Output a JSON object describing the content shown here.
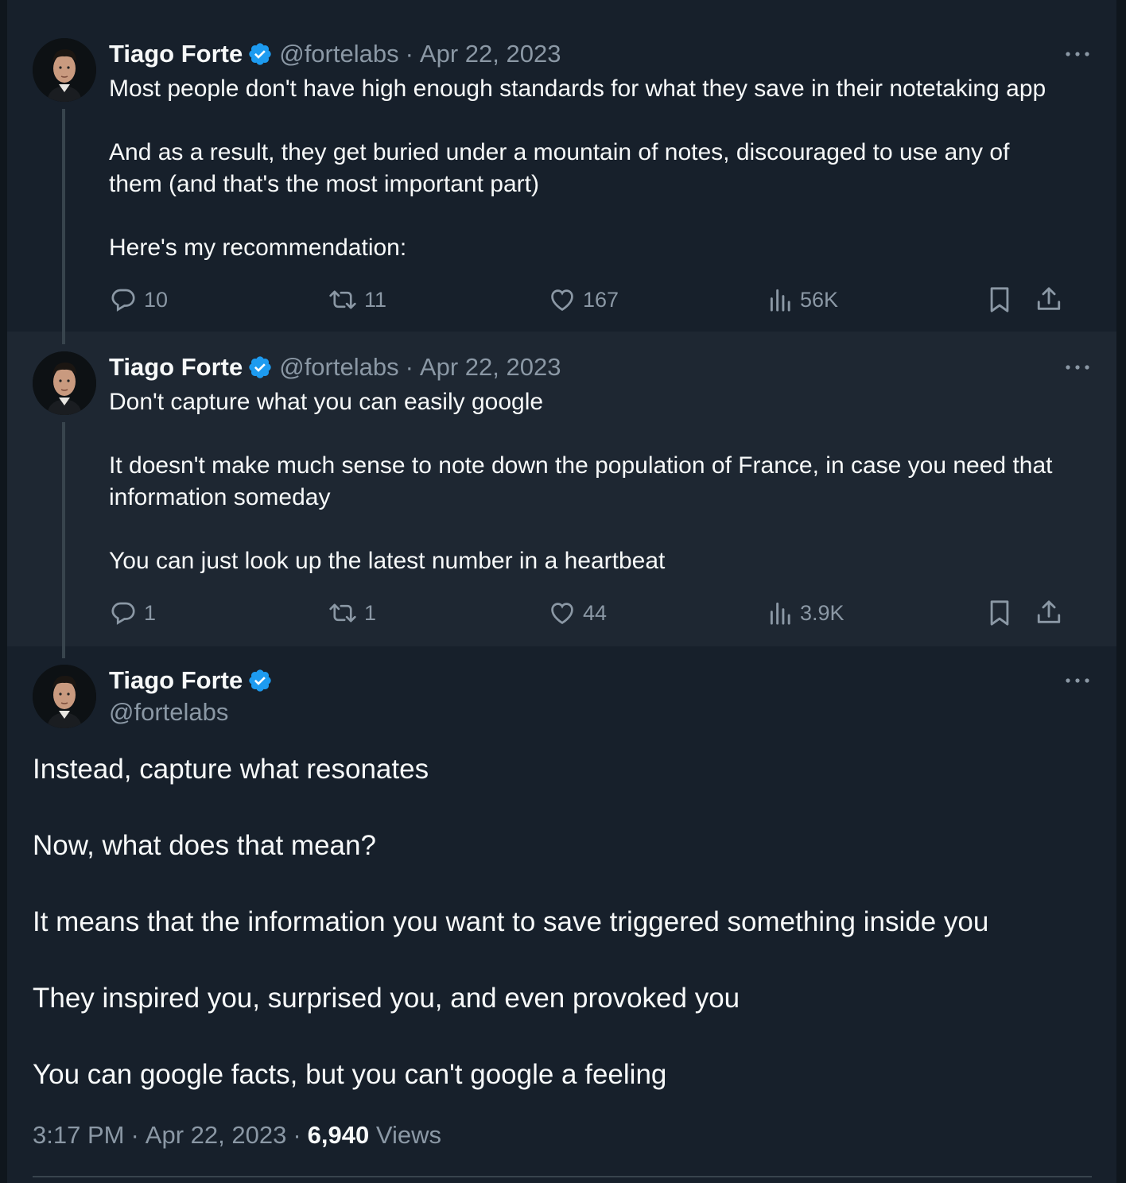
{
  "author": {
    "name": "Tiago Forte",
    "handle": "@fortelabs",
    "verified_color": "#1d9bf0"
  },
  "tweets": [
    {
      "date": "Apr 22, 2023",
      "lines": [
        "Most people don't have high enough standards for what they save in their notetaking app",
        "",
        "And as a result, they get buried under a mountain of notes, discouraged to use any of",
        "them (and that's the most important part)",
        "",
        "Here's my recommendation:"
      ],
      "replies": "10",
      "retweets": "11",
      "likes": "167",
      "views": "56K"
    },
    {
      "date": "Apr 22, 2023",
      "lines": [
        "Don't capture what you can easily google",
        "",
        "It doesn't make much sense to note down the population of France, in case you need that",
        "information someday",
        "",
        "You can just look up the latest number in a heartbeat"
      ],
      "replies": "1",
      "retweets": "1",
      "likes": "44",
      "views": "3.9K"
    }
  ],
  "main_tweet": {
    "paragraphs": [
      "Instead, capture what resonates",
      "Now, what does that mean?",
      "It means that the information you want to save triggered something inside you",
      "They inspired you, surprised you, and even provoked you",
      "You can google facts, but you can't google a feeling"
    ],
    "time": "3:17 PM",
    "date": "Apr 22, 2023",
    "separator": "·",
    "views_count": "6,940",
    "views_label": "Views"
  },
  "icons": {
    "reply": "reply-icon",
    "retweet": "retweet-icon",
    "like": "heart-icon",
    "views": "analytics-icon",
    "bookmark": "bookmark-icon",
    "share": "share-icon",
    "more": "more-icon",
    "verified": "verified-icon"
  }
}
